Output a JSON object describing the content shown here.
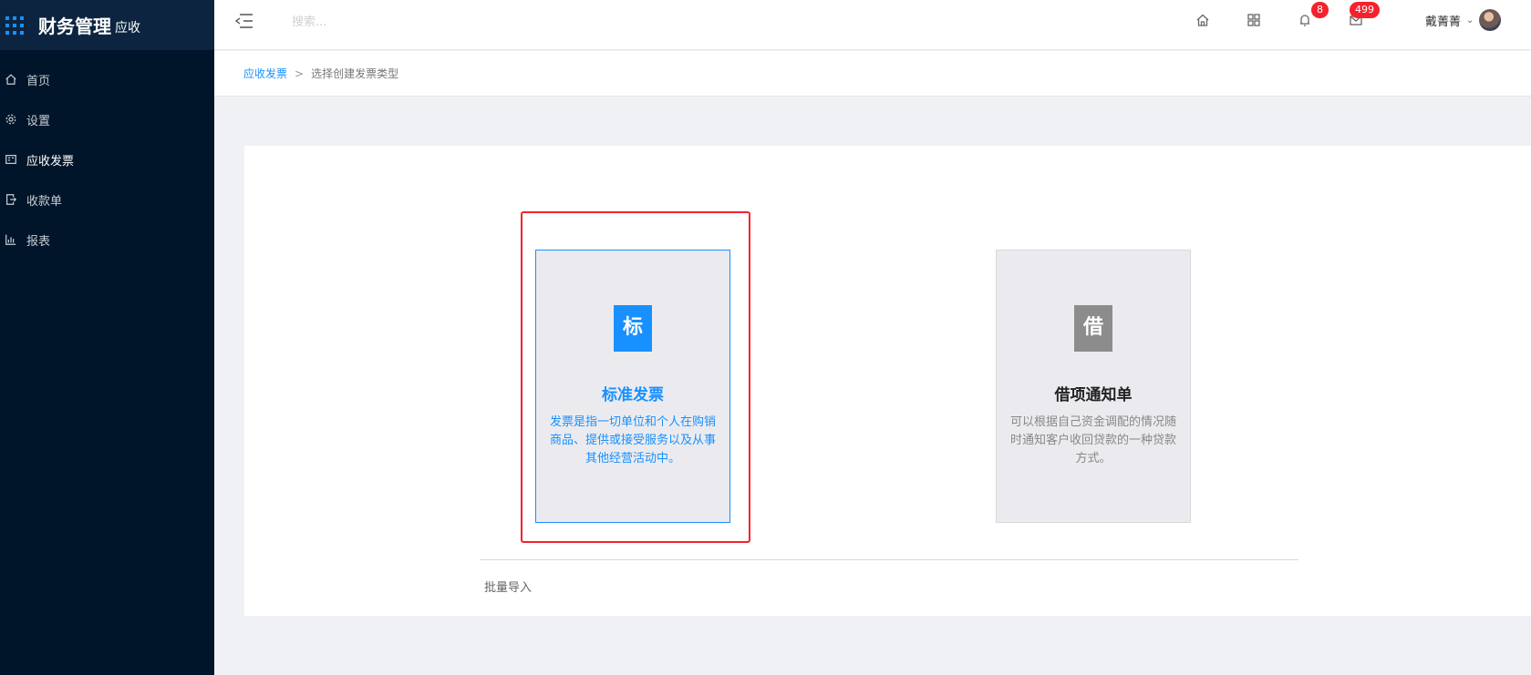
{
  "app": {
    "title": "财务管理",
    "subtitle": "应收"
  },
  "sidebar": {
    "items": [
      {
        "label": "首页",
        "icon": "home-icon"
      },
      {
        "label": "设置",
        "icon": "gear-icon"
      },
      {
        "label": "应收发票",
        "icon": "invoice-icon",
        "active": true
      },
      {
        "label": "收款单",
        "icon": "receipt-icon"
      },
      {
        "label": "报表",
        "icon": "bar-chart-icon"
      }
    ]
  },
  "header": {
    "search_placeholder": "搜索...",
    "notifications_count": "8",
    "messages_count": "499",
    "user_name": "戴菁菁"
  },
  "breadcrumb": {
    "parent": "应收发票",
    "separator": ">",
    "current": "选择创建发票类型"
  },
  "cards": [
    {
      "icon_char": "标",
      "title": "标准发票",
      "description": "发票是指一切单位和个人在购销商品、提供或接受服务以及从事其他经营活动中。",
      "selected": true
    },
    {
      "icon_char": "借",
      "title": "借项通知单",
      "description": "可以根据自己资金调配的情况随时通知客户收回贷款的一种贷款方式。",
      "selected": false
    }
  ],
  "batch_import_label": "批量导入",
  "colors": {
    "sidebar_bg": "#001529",
    "accent": "#1890ff",
    "highlight_red": "#f5222d",
    "card_gray_icon": "#8c8c8c"
  }
}
